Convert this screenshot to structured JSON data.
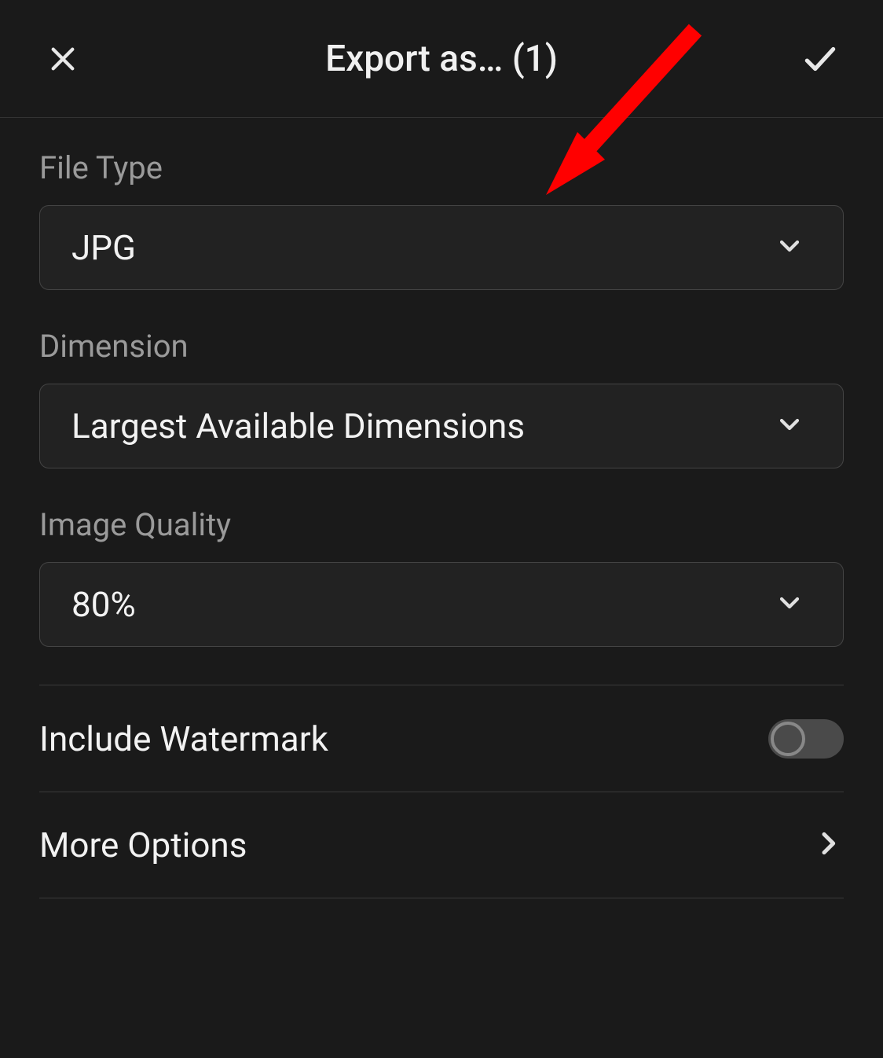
{
  "header": {
    "title": "Export as… (1)"
  },
  "fileType": {
    "label": "File Type",
    "value": "JPG"
  },
  "dimension": {
    "label": "Dimension",
    "value": "Largest Available Dimensions"
  },
  "imageQuality": {
    "label": "Image Quality",
    "value": "80%"
  },
  "watermark": {
    "label": "Include Watermark",
    "enabled": false
  },
  "moreOptions": {
    "label": "More Options"
  },
  "annotation": {
    "arrow_color": "#ff0000"
  }
}
